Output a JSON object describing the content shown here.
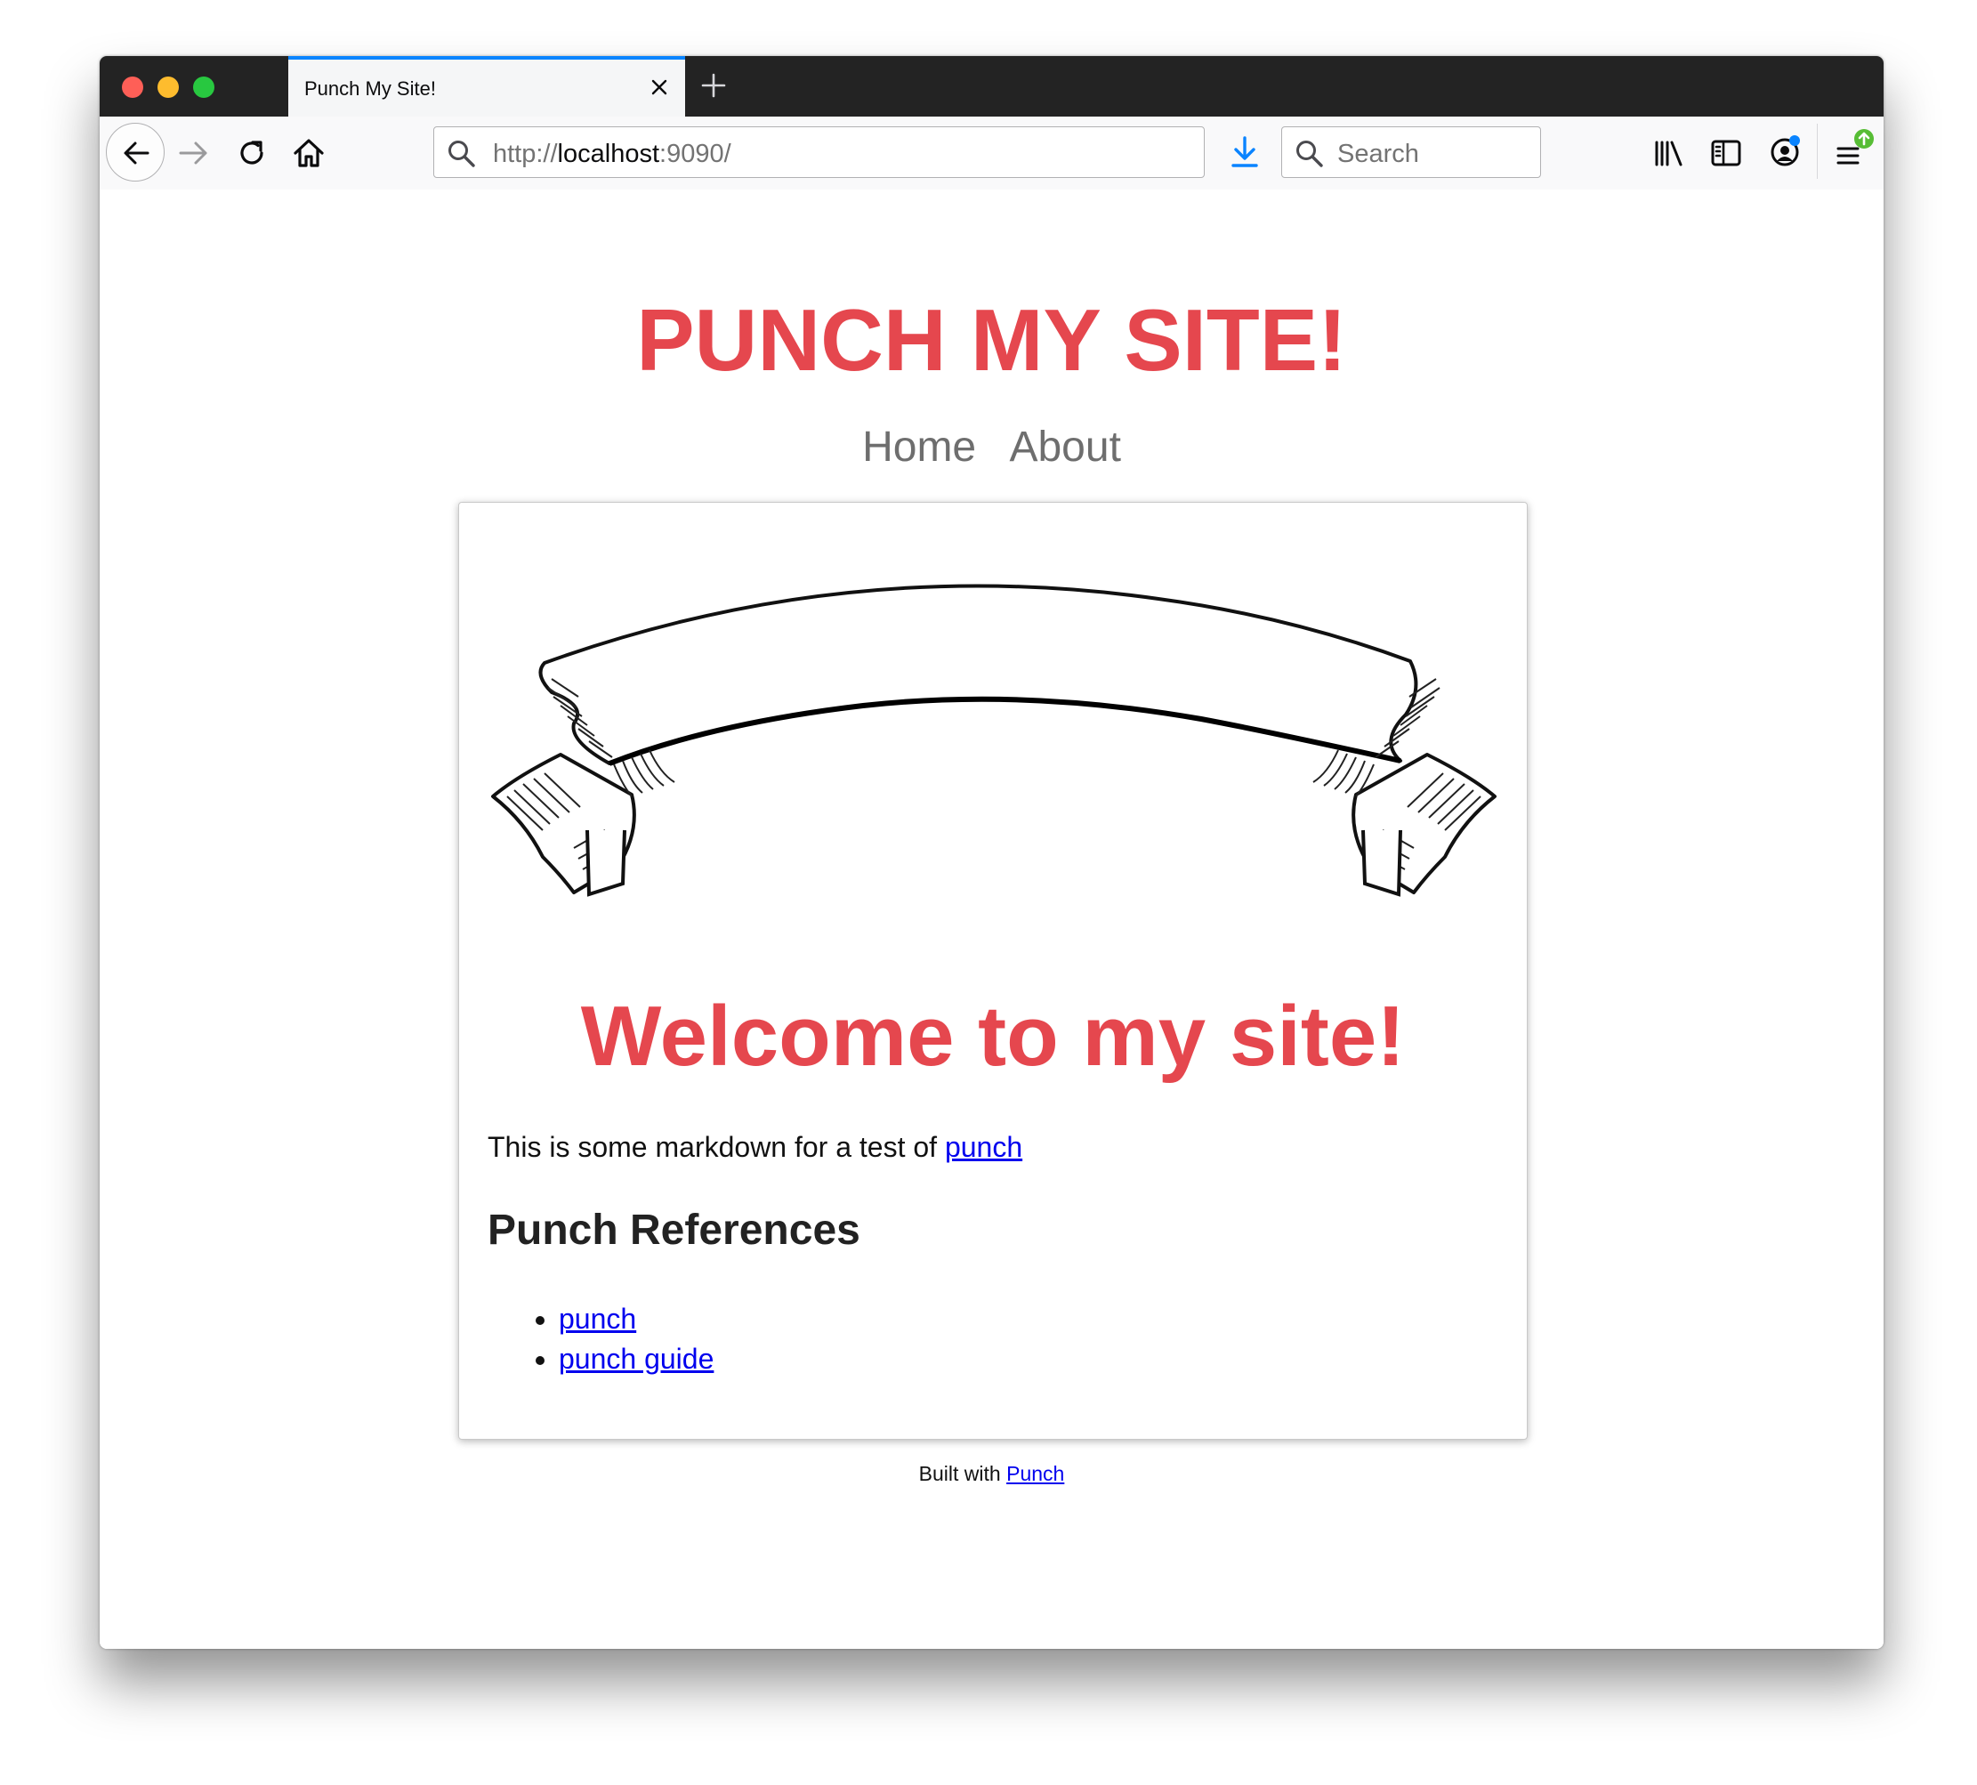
{
  "browser": {
    "tab_title": "Punch My Site!",
    "url_prefix": "http://",
    "url_host": "localhost",
    "url_suffix": ":9090/",
    "search_placeholder": "Search",
    "icons": [
      "back-arrow-icon",
      "forward-arrow-icon",
      "reload-icon",
      "home-icon",
      "download-icon",
      "library-icon",
      "sidebar-icon",
      "account-icon",
      "menu-icon",
      "close-icon",
      "plus-icon",
      "search-icon"
    ],
    "colors": {
      "tab_accent": "#0a84ff",
      "download_icon": "#0a84ff",
      "update_badge": "#57bd35",
      "account_dot": "#0a84ff"
    }
  },
  "site": {
    "title": "PUNCH MY SITE!",
    "nav": [
      {
        "label": "Home"
      },
      {
        "label": "About"
      }
    ],
    "colors": {
      "accent": "#e5474e",
      "link": "#0000ee"
    }
  },
  "main": {
    "heading": "Welcome to my site!",
    "intro_text": "This is some markdown for a test of ",
    "intro_link": "punch",
    "references_heading": "Punch References",
    "references": [
      {
        "label": "punch"
      },
      {
        "label": "punch guide"
      }
    ]
  },
  "footer": {
    "text": "Built with ",
    "link": "Punch"
  }
}
